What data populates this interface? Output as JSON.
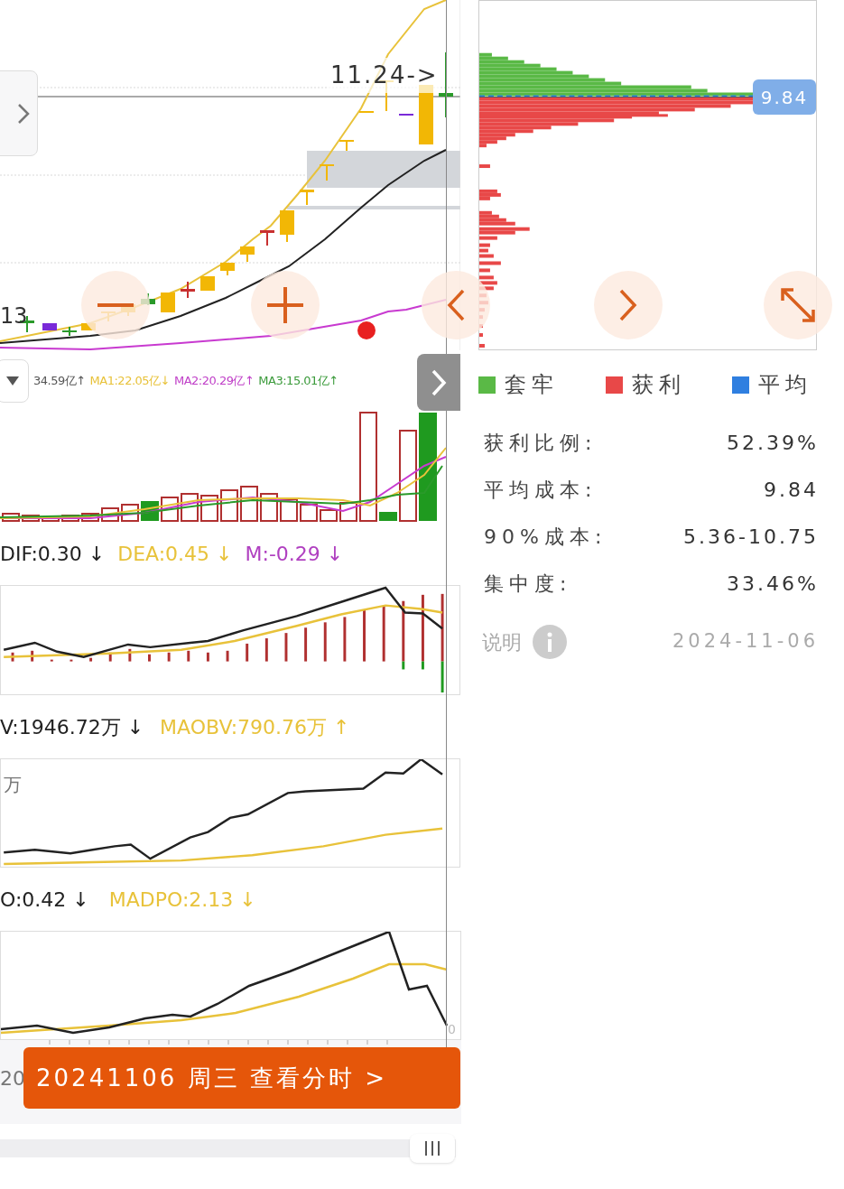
{
  "main_chart": {
    "price_label": "11.24->",
    "left_label": "13"
  },
  "volume": {
    "indicators": [
      {
        "text": "34.59亿↑",
        "color": "#555555"
      },
      {
        "text": "MA1:22.05亿↓",
        "color": "#e8c23a"
      },
      {
        "text": "MA2:20.29亿↑",
        "color": "#c040c8"
      },
      {
        "text": "MA3:15.01亿↑",
        "color": "#3a9a3a"
      }
    ]
  },
  "macd": {
    "indicators": [
      {
        "text": "DIF:0.30 ↓",
        "color": "#222222"
      },
      {
        "text": "DEA:0.45 ↓",
        "color": "#e8c23a"
      },
      {
        "text": "M:-0.29 ↓",
        "color": "#b040c0"
      }
    ]
  },
  "obv": {
    "indicators": [
      {
        "text": "V:1946.72万 ↓",
        "color": "#222222"
      },
      {
        "text": "MAOBV:790.76万 ↑",
        "color": "#e8c23a"
      }
    ],
    "unit": "万"
  },
  "dpo": {
    "indicators": [
      {
        "text": "O:0.42 ↓",
        "color": "#222222"
      },
      {
        "text": "MADPO:2.13 ↓",
        "color": "#e8c23a"
      }
    ],
    "axis_label": "0"
  },
  "date_bar": {
    "partial": "20",
    "button": "20241106 周三 查看分时 >"
  },
  "chip": {
    "price_badge": "9.84",
    "legend": [
      {
        "label": "套牢",
        "color": "#5ab946"
      },
      {
        "label": "获利",
        "color": "#e84848"
      },
      {
        "label": "平均",
        "color": "#2f7fe0"
      }
    ],
    "stats": [
      {
        "label": "获利比例:",
        "value": "52.39%"
      },
      {
        "label": "平均成本:",
        "value": "9.84"
      },
      {
        "label": "90%成本:",
        "value": "5.36-10.75"
      },
      {
        "label": "集中度:",
        "value": "33.46%"
      }
    ],
    "help": "说明",
    "date": "2024-11-06"
  }
}
